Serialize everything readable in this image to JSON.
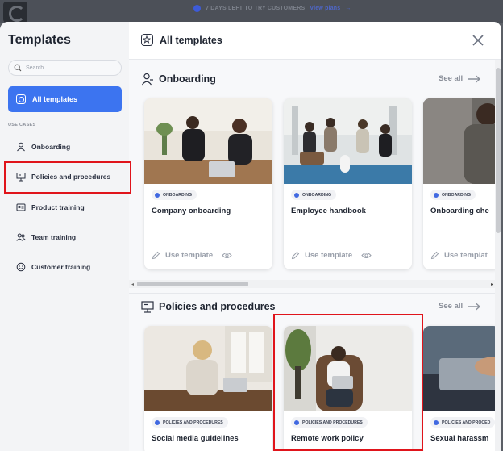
{
  "background": {
    "banner_text": "7 DAYS LEFT TO TRY CUSTOMERS",
    "banner_link": "View plans"
  },
  "sidebar": {
    "title": "Templates",
    "search_placeholder": "Search",
    "all_templates_label": "All templates",
    "use_cases_label": "USE CASES",
    "items": [
      {
        "label": "Onboarding",
        "icon": "person-icon"
      },
      {
        "label": "Policies and procedures",
        "icon": "presentation-icon"
      },
      {
        "label": "Product training",
        "icon": "id-card-icon"
      },
      {
        "label": "Team training",
        "icon": "people-icon"
      },
      {
        "label": "Customer training",
        "icon": "smiley-icon"
      }
    ]
  },
  "main": {
    "title": "All templates",
    "sections": [
      {
        "title": "Onboarding",
        "see_all": "See all",
        "cards": [
          {
            "badge": "ONBOARDING",
            "title": "Company onboarding",
            "action": "Use template"
          },
          {
            "badge": "ONBOARDING",
            "title": "Employee handbook",
            "action": "Use template"
          },
          {
            "badge": "ONBOARDING",
            "title": "Onboarding che",
            "action": "Use templat"
          }
        ]
      },
      {
        "title": "Policies and procedures",
        "see_all": "See all",
        "cards": [
          {
            "badge": "POLICIES AND PROCEDURES",
            "title": "Social media guidelines"
          },
          {
            "badge": "POLICIES AND PROCEDURES",
            "title": "Remote work policy"
          },
          {
            "badge": "POLICIES AND PROCED",
            "title": "Sexual harassm"
          }
        ]
      }
    ]
  },
  "colors": {
    "accent": "#3c74f0",
    "highlight": "#e0141b",
    "badge_dot": "#4169e1"
  }
}
